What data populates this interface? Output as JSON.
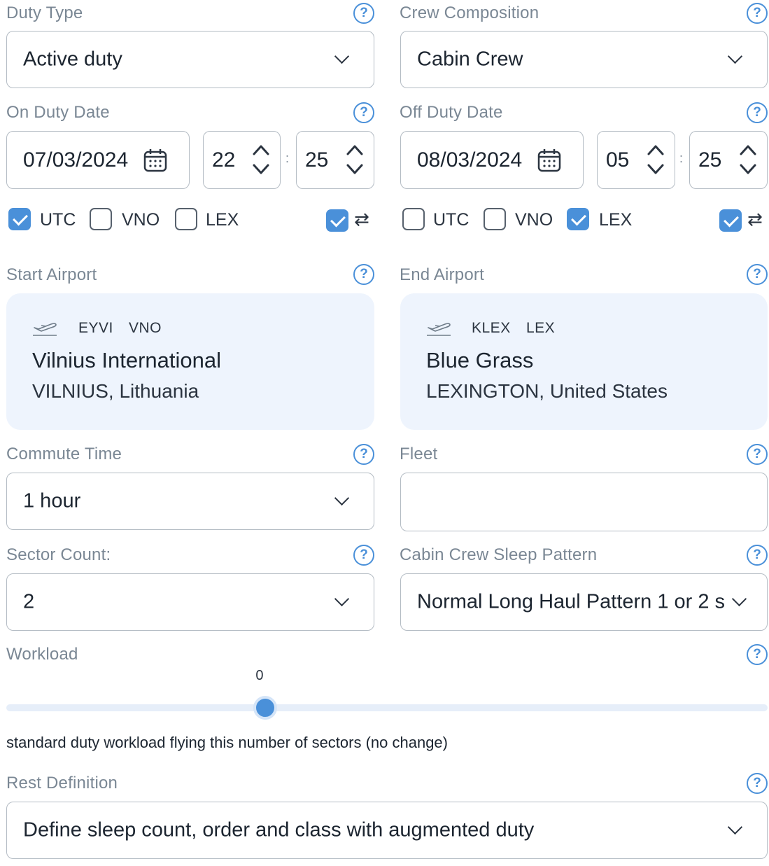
{
  "duty_type": {
    "label": "Duty Type",
    "value": "Active duty"
  },
  "crew_composition": {
    "label": "Crew Composition",
    "value": "Cabin Crew"
  },
  "on_duty": {
    "label": "On Duty Date",
    "date": "07/03/2024",
    "hour": "22",
    "minute": "25",
    "separator": ":",
    "timezones": [
      {
        "label": "UTC",
        "checked": true
      },
      {
        "label": "VNO",
        "checked": false
      },
      {
        "label": "LEX",
        "checked": false
      }
    ],
    "sync_checked": true,
    "swap_icon": "⇄"
  },
  "off_duty": {
    "label": "Off Duty Date",
    "date": "08/03/2024",
    "hour": "05",
    "minute": "25",
    "separator": ":",
    "timezones": [
      {
        "label": "UTC",
        "checked": false
      },
      {
        "label": "VNO",
        "checked": false
      },
      {
        "label": "LEX",
        "checked": true
      }
    ],
    "sync_checked": true,
    "swap_icon": "⇄"
  },
  "start_airport": {
    "label": "Start Airport",
    "icao": "EYVI",
    "iata": "VNO",
    "name": "Vilnius International",
    "city": "VILNIUS, Lithuania"
  },
  "end_airport": {
    "label": "End Airport",
    "icao": "KLEX",
    "iata": "LEX",
    "name": "Blue Grass",
    "city": "LEXINGTON, United States"
  },
  "commute_time": {
    "label": "Commute Time",
    "value": "1 hour"
  },
  "fleet": {
    "label": "Fleet",
    "value": ""
  },
  "sector_count": {
    "label": "Sector Count:",
    "value": "2"
  },
  "sleep_pattern": {
    "label": "Cabin Crew Sleep Pattern",
    "value": "Normal Long Haul Pattern 1 or 2 s"
  },
  "workload": {
    "label": "Workload",
    "value": "0",
    "level_fraction": 0.34,
    "description": "standard duty workload flying this number of sectors (no change)"
  },
  "rest_definition": {
    "label": "Rest Definition",
    "value": "Define sleep count, order and class with augmented duty"
  },
  "help_glyph": "?",
  "colors": {
    "accent": "#4a90d9",
    "label": "#7a8794",
    "airport_bg": "#eef4fd",
    "border": "#b4bcc4"
  }
}
